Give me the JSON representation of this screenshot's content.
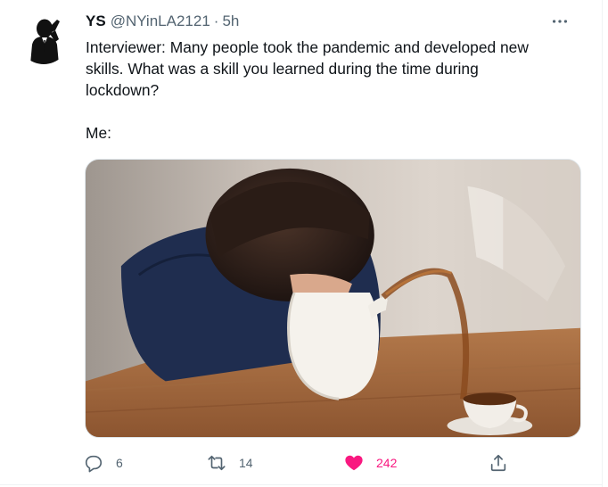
{
  "tweet": {
    "author": {
      "display_name": "YS",
      "handle": "@NYinLA2121",
      "separator": "·",
      "time": "5h",
      "avatar_icon": "man-on-phone-silhouette-avatar"
    },
    "text_lines": [
      "Interviewer: Many people took the pandemic and developed new",
      "skills. What was a skill you learned during the time during",
      "lockdown?"
    ],
    "text_reply": "Me:",
    "media": {
      "description_icon": "photo-boy-pouring-from-teapot-mouth"
    },
    "actions": {
      "reply": {
        "icon": "reply-icon",
        "count": "6"
      },
      "retweet": {
        "icon": "retweet-icon",
        "count": "14"
      },
      "like": {
        "icon": "heart-filled-icon",
        "count": "242",
        "active_color": "#f91880"
      },
      "share": {
        "icon": "share-icon"
      }
    },
    "more_icon": "more-horizontal-icon"
  },
  "colors": {
    "text_primary": "#0f1419",
    "text_secondary": "#536471",
    "like_active": "#f91880"
  }
}
